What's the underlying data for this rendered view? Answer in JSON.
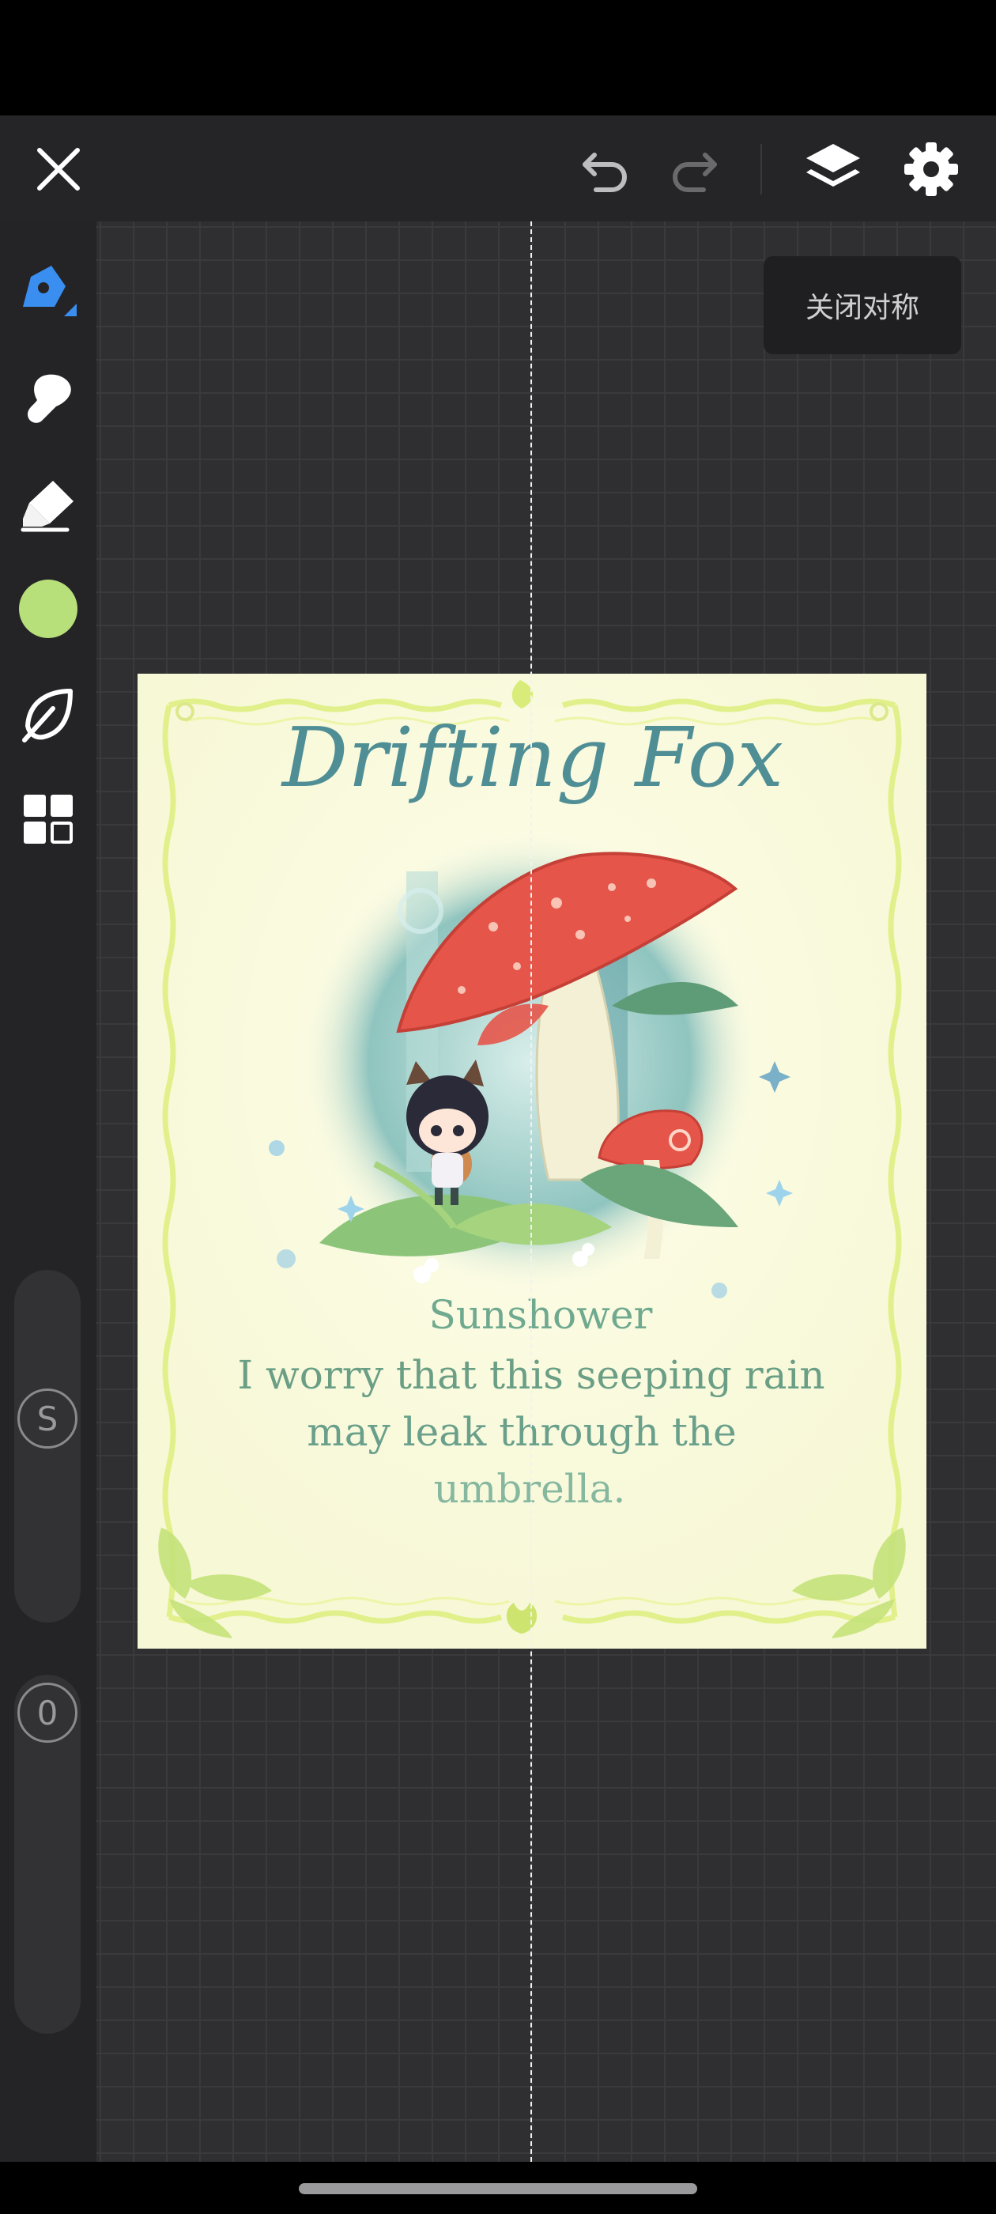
{
  "toolbar": {
    "close_icon": "close-icon",
    "undo_icon": "undo-icon",
    "redo_icon": "redo-icon",
    "layers_icon": "layers-icon",
    "settings_icon": "gear-icon"
  },
  "tools": [
    {
      "name": "pen",
      "icon": "pen-icon",
      "active": true,
      "color": "#3a8ef0"
    },
    {
      "name": "smudge",
      "icon": "smudge-icon"
    },
    {
      "name": "eraser",
      "icon": "eraser-icon"
    },
    {
      "name": "color",
      "icon": "color-swatch",
      "color": "#b7df7a"
    },
    {
      "name": "brush-library",
      "icon": "leaf-icon"
    },
    {
      "name": "gallery",
      "icon": "grid-icon"
    }
  ],
  "sliders": {
    "size_label": "S",
    "opacity_label": "0"
  },
  "symmetry": {
    "tooltip": "关闭对称"
  },
  "artwork": {
    "title": "Drifting Fox",
    "subtitle": "Sunshower",
    "poem_line1": "I worry that this seeping rain",
    "poem_line2": "may leak through the",
    "poem_line3": "umbrella.",
    "colors": {
      "paper": "#fbfbe4",
      "frame": "#e9f59a",
      "title": "#4f8e95",
      "subtitle": "#6fa98f",
      "mushroom": "#e6554a"
    }
  }
}
